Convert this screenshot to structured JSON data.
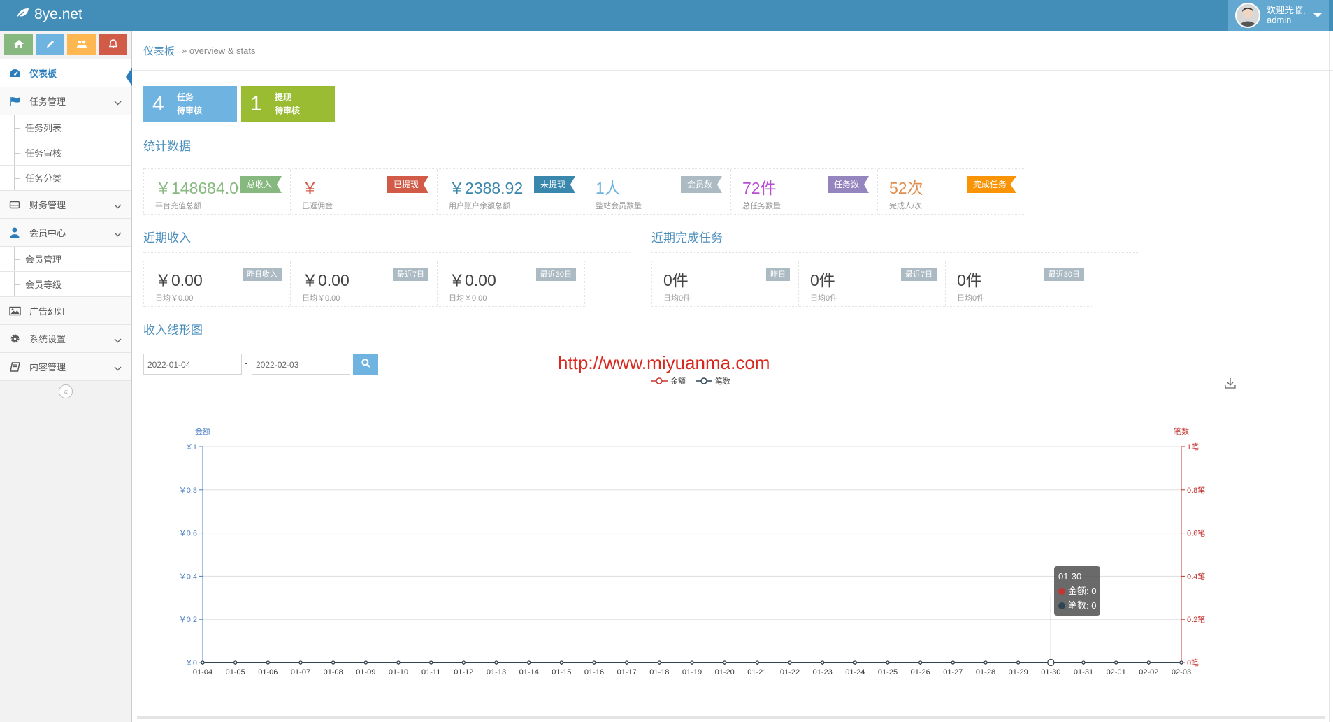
{
  "brand": {
    "name": "8ye.net"
  },
  "user": {
    "welcome": "欢迎光临,",
    "name": "admin"
  },
  "sidebar": {
    "items": [
      {
        "label": "仪表板"
      },
      {
        "label": "任务管理",
        "children": [
          "任务列表",
          "任务审核",
          "任务分类"
        ]
      },
      {
        "label": "财务管理"
      },
      {
        "label": "会员中心",
        "children": [
          "会员管理",
          "会员等级"
        ]
      },
      {
        "label": "广告幻灯"
      },
      {
        "label": "系统设置"
      },
      {
        "label": "内容管理"
      }
    ],
    "collapse": "«"
  },
  "breadcrumb": {
    "home": "仪表板",
    "sub": "» overview & stats"
  },
  "tiles": [
    {
      "num": "4",
      "line1": "任务",
      "line2": "待审核",
      "color": "#6fb3e0"
    },
    {
      "num": "1",
      "line1": "提现",
      "line2": "待审核",
      "color": "#9abc32"
    }
  ],
  "sections": {
    "stats": "统计数据",
    "recent_income": "近期收入",
    "recent_tasks": "近期完成任务",
    "chart": "收入线形图"
  },
  "stats": [
    {
      "value": "￥148684.00",
      "label": "平台充值总额",
      "tag": "总收入",
      "value_color": "#87b87f",
      "tag_color": "#87b87f"
    },
    {
      "value": "￥",
      "label": "已返佣金",
      "tag": "已提现",
      "value_color": "#d15b47",
      "tag_color": "#d15b47"
    },
    {
      "value": "￥2388.92",
      "label": "用户账户余额总额",
      "tag": "未提现",
      "value_color": "#3a87ad",
      "tag_color": "#3a87ad"
    },
    {
      "value": "1人",
      "label": "整站会员数量",
      "tag": "会员数",
      "value_color": "#6fb3e0",
      "tag_color": "#abbac3"
    },
    {
      "value": "72件",
      "label": "总任务数量",
      "tag": "任务数",
      "value_color": "#b74fd2",
      "tag_color": "#9585bf"
    },
    {
      "value": "52次",
      "label": "完成人/次",
      "tag": "完成任务",
      "value_color": "#e08e4f",
      "tag_color": "#f89406"
    }
  ],
  "income": [
    {
      "value": "￥0.00",
      "label": "日均￥0.00",
      "tag": "昨日收入"
    },
    {
      "value": "￥0.00",
      "label": "日均￥0.00",
      "tag": "最近7日"
    },
    {
      "value": "￥0.00",
      "label": "日均￥0.00",
      "tag": "最近30日"
    }
  ],
  "tasks": [
    {
      "value": "0件",
      "label": "日均0件",
      "tag": "昨日"
    },
    {
      "value": "0件",
      "label": "日均0件",
      "tag": "最近7日"
    },
    {
      "value": "0件",
      "label": "日均0件",
      "tag": "最近30日"
    }
  ],
  "filter": {
    "start": "2022-01-04",
    "sep": "-",
    "end": "2022-02-03"
  },
  "watermark": "http://www.miyuanma.com",
  "tooltip": {
    "date": "01-30",
    "amount": "金额: 0",
    "count": "笔数: 0"
  },
  "chart_data": {
    "type": "line",
    "x": [
      "01-04",
      "01-05",
      "01-06",
      "01-07",
      "01-08",
      "01-09",
      "01-10",
      "01-11",
      "01-12",
      "01-13",
      "01-14",
      "01-15",
      "01-16",
      "01-17",
      "01-18",
      "01-19",
      "01-20",
      "01-21",
      "01-22",
      "01-23",
      "01-24",
      "01-25",
      "01-26",
      "01-27",
      "01-28",
      "01-29",
      "01-30",
      "01-31",
      "02-01",
      "02-02",
      "02-03"
    ],
    "series": [
      {
        "name": "金额",
        "axis": "left",
        "color": "#c23531",
        "values": [
          0,
          0,
          0,
          0,
          0,
          0,
          0,
          0,
          0,
          0,
          0,
          0,
          0,
          0,
          0,
          0,
          0,
          0,
          0,
          0,
          0,
          0,
          0,
          0,
          0,
          0,
          0,
          0,
          0,
          0,
          0
        ]
      },
      {
        "name": "笔数",
        "axis": "right",
        "color": "#2f4554",
        "values": [
          0,
          0,
          0,
          0,
          0,
          0,
          0,
          0,
          0,
          0,
          0,
          0,
          0,
          0,
          0,
          0,
          0,
          0,
          0,
          0,
          0,
          0,
          0,
          0,
          0,
          0,
          0,
          0,
          0,
          0,
          0
        ]
      }
    ],
    "ylabel": "金额",
    "ylabel_right": "笔数",
    "ylim": [
      0,
      1
    ],
    "y_ticks": [
      "￥0",
      "￥0.2",
      "￥0.4",
      "￥0.6",
      "￥0.8",
      "￥1"
    ],
    "y_ticks_right": [
      "0笔",
      "0.2笔",
      "0.4笔",
      "0.6笔",
      "0.8笔",
      "1笔"
    ],
    "left_axis_color": "#4a7fc1",
    "right_axis_color": "#c23531",
    "grid": true,
    "legend": "top-center",
    "highlight": "01-30"
  }
}
